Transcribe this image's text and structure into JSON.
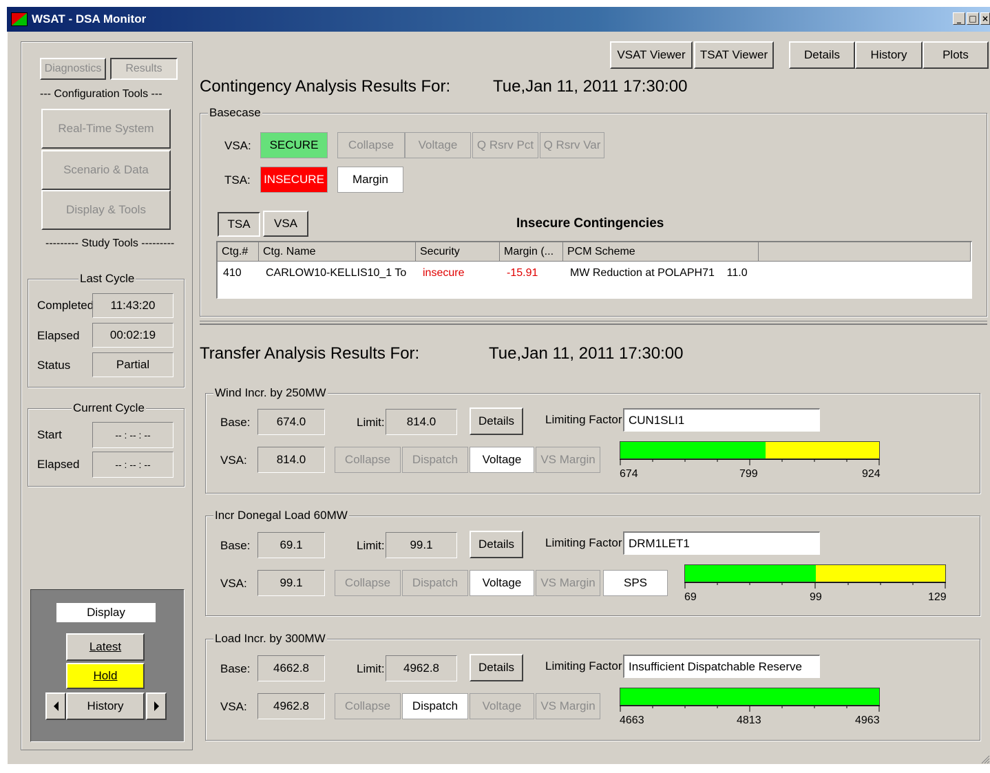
{
  "window": {
    "title": "WSAT - DSA Monitor",
    "min": "_",
    "max": "□",
    "close": "×"
  },
  "sidebar": {
    "tabs": {
      "diagnostics": "Diagnostics",
      "results": "Results"
    },
    "config_header": "--- Configuration Tools ---",
    "config_buttons": [
      "Real-Time System",
      "Scenario & Data",
      "Display & Tools"
    ],
    "study_header": "--------- Study Tools ---------",
    "last_cycle": {
      "title": "Last Cycle",
      "completed_label": "Completed",
      "completed": "11:43:20",
      "elapsed_label": "Elapsed",
      "elapsed": "00:02:19",
      "status_label": "Status",
      "status": "Partial"
    },
    "current_cycle": {
      "title": "Current Cycle",
      "start_label": "Start",
      "start": "-- : -- : --",
      "elapsed_label": "Elapsed",
      "elapsed": "-- : -- : --"
    },
    "display": {
      "title": "Display",
      "latest": "Latest",
      "hold": "Hold",
      "history": "History"
    }
  },
  "toolbar": {
    "vsat_viewer": "VSAT Viewer",
    "tsat_viewer": "TSAT Viewer",
    "details": "Details",
    "history": "History",
    "plots": "Plots"
  },
  "contingency": {
    "title": "Contingency Analysis Results For:",
    "datetime": "Tue,Jan 11, 2011 17:30:00",
    "basecase_label": "Basecase",
    "vsa_label": "VSA:",
    "vsa_status": "SECURE",
    "vsa_buttons": [
      "Collapse",
      "Voltage",
      "Q Rsrv Pct",
      "Q Rsrv Var"
    ],
    "tsa_label": "TSA:",
    "tsa_status": "INSECURE",
    "tsa_margin": "Margin",
    "tabs": [
      "TSA",
      "VSA"
    ],
    "table_title": "Insecure Contingencies",
    "columns": [
      "Ctg.#",
      "Ctg. Name",
      "Security",
      "Margin (...",
      "PCM Scheme"
    ],
    "rows": [
      {
        "ctg": "410",
        "name": "CARLOW10-KELLIS10_1 To",
        "security": "insecure",
        "margin": "-15.91",
        "pcm": "MW Reduction at POLAPH71    11.0"
      }
    ]
  },
  "transfer": {
    "title": "Transfer Analysis Results For:",
    "datetime": "Tue,Jan 11, 2011 17:30:00",
    "common": {
      "base_label": "Base:",
      "limit_label": "Limit:",
      "vsa_label": "VSA:",
      "details": "Details",
      "limiting_factor_label": "Limiting Factor:",
      "collapse": "Collapse",
      "dispatch": "Dispatch",
      "voltage": "Voltage",
      "vs_margin": "VS Margin"
    },
    "groups": [
      {
        "name": "Wind Incr. by 250MW",
        "base": "674.0",
        "limit": "814.0",
        "vsa": "814.0",
        "limiting_factor": "CUN1SLI1",
        "active_button": "Voltage",
        "bar": {
          "min": 674,
          "max": 924,
          "green_to": 814,
          "labels": [
            "674",
            "799",
            "924"
          ]
        }
      },
      {
        "name": "Incr Donegal Load 60MW",
        "base": "69.1",
        "limit": "99.1",
        "vsa": "99.1",
        "limiting_factor": "DRM1LET1",
        "active_button": "Voltage",
        "extra": "SPS",
        "bar": {
          "min": 69,
          "max": 129,
          "green_to": 99.1,
          "labels": [
            "69",
            "99",
            "129"
          ]
        }
      },
      {
        "name": "Load Incr. by 300MW",
        "base": "4662.8",
        "limit": "4962.8",
        "vsa": "4962.8",
        "limiting_factor": "Insufficient Dispatchable Reserve",
        "active_button": "Dispatch",
        "bar": {
          "min": 4663,
          "max": 4963,
          "green_to": 4963,
          "labels": [
            "4663",
            "4813",
            "4963"
          ]
        }
      }
    ]
  },
  "colors": {
    "secure": "#66e07a",
    "insecure": "#ff0000",
    "bar_green": "#00ff00",
    "bar_yellow": "#ffff00",
    "hold": "#ffff00",
    "panel": "#d4d0c8"
  }
}
